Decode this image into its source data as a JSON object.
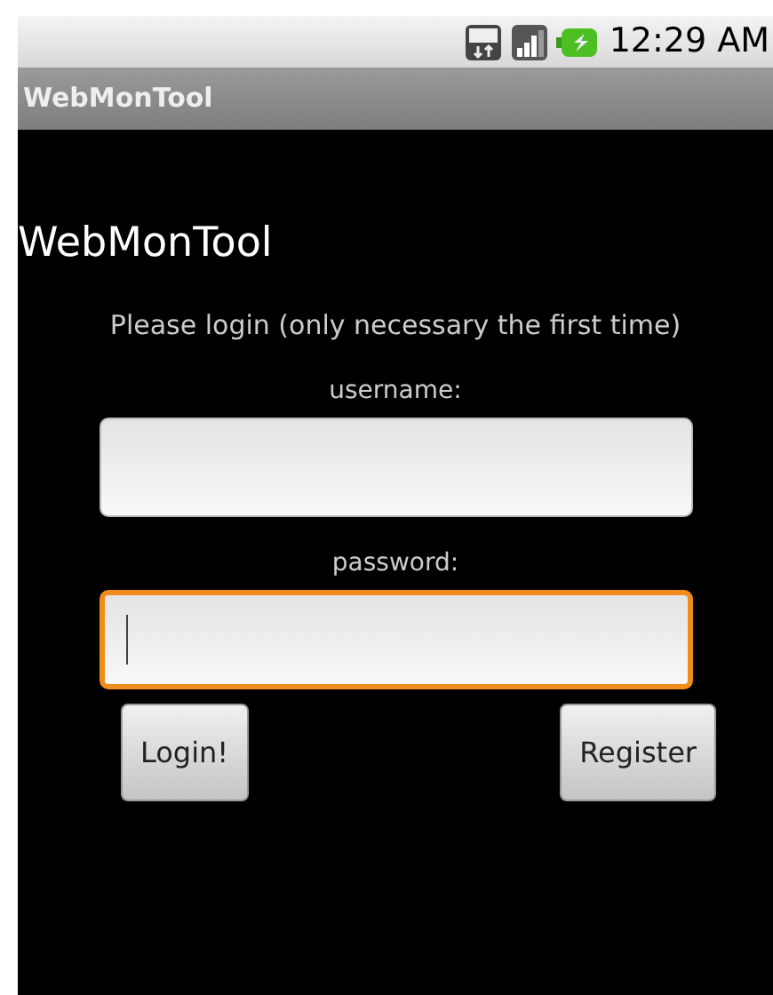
{
  "status_bar": {
    "time": "12:29 AM"
  },
  "title_bar": {
    "title": "WebMonTool"
  },
  "heading": "WebMonTool",
  "instruction": "Please login (only necessary the first time)",
  "fields": [
    {
      "label": "username:",
      "focused": false
    },
    {
      "label": "password:",
      "focused": true
    }
  ],
  "buttons": [
    "Login!",
    "Register"
  ]
}
